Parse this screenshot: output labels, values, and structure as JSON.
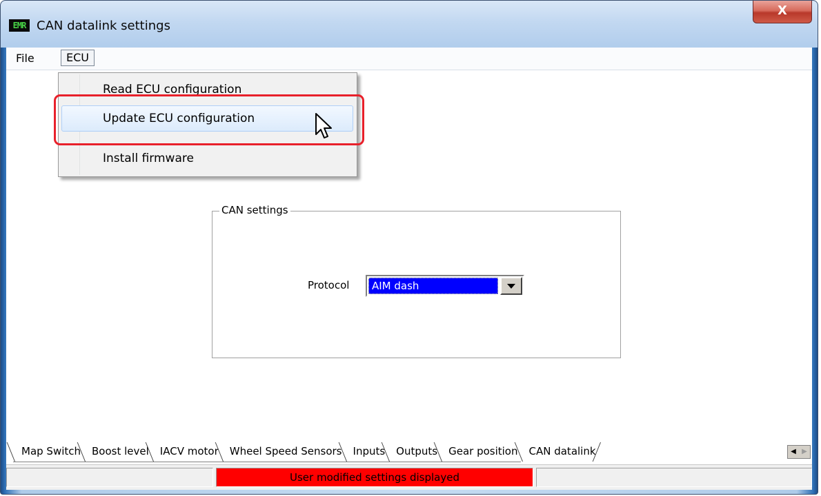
{
  "window": {
    "title": "CAN datalink settings",
    "icon_text": "EMR",
    "close_label": "X"
  },
  "menubar": {
    "file_label": "File",
    "ecu_label": "ECU"
  },
  "ecu_menu": {
    "items": [
      {
        "label": "Read ECU configuration"
      },
      {
        "label": "Update ECU configuration"
      },
      {
        "label": "Install firmware"
      }
    ]
  },
  "can_settings": {
    "group_label": "CAN settings",
    "protocol_label": "Protocol",
    "protocol_value": "AIM dash"
  },
  "tabs": [
    {
      "label": "Map Switch"
    },
    {
      "label": "Boost level"
    },
    {
      "label": "IACV motor"
    },
    {
      "label": "Wheel Speed Sensors"
    },
    {
      "label": "Inputs"
    },
    {
      "label": "Outputs"
    },
    {
      "label": "Gear position"
    },
    {
      "label": "CAN datalink"
    }
  ],
  "statusbar": {
    "message": "User modified settings displayed"
  },
  "colors": {
    "status_alert": "#ff0000",
    "highlight": "#e8202a",
    "selection": "#0000ff"
  }
}
